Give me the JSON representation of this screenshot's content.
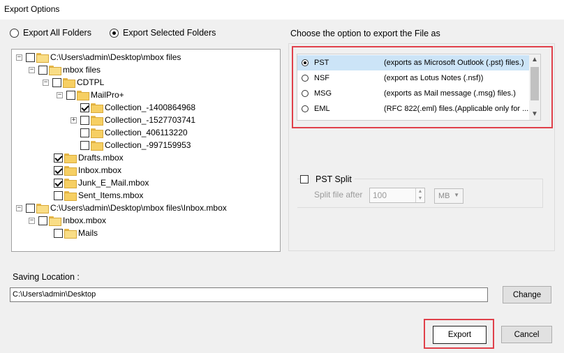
{
  "window": {
    "title": "Export Options"
  },
  "mode": {
    "options": [
      {
        "label": "Export All Folders",
        "selected": false
      },
      {
        "label": "Export Selected Folders",
        "selected": true
      }
    ]
  },
  "tree": {
    "nodes": [
      {
        "label": "C:\\Users\\admin\\Desktop\\mbox files",
        "expander": "−",
        "checked": false
      },
      {
        "label": "mbox files",
        "expander": "−",
        "checked": false
      },
      {
        "label": "CDTPL",
        "expander": "−",
        "checked": false
      },
      {
        "label": "MailPro+",
        "expander": "−",
        "checked": false
      },
      {
        "label": "Collection_-1400864968",
        "expander": "",
        "checked": true
      },
      {
        "label": "Collection_-1527703741",
        "expander": "+",
        "checked": false
      },
      {
        "label": "Collection_406113220",
        "expander": "",
        "checked": false
      },
      {
        "label": "Collection_-997159953",
        "expander": "",
        "checked": false
      },
      {
        "label": "Drafts.mbox",
        "expander": "",
        "checked": true
      },
      {
        "label": "Inbox.mbox",
        "expander": "",
        "checked": true
      },
      {
        "label": "Junk_E_Mail.mbox",
        "expander": "",
        "checked": true
      },
      {
        "label": "Sent_Items.mbox",
        "expander": "",
        "checked": false
      },
      {
        "label": "C:\\Users\\admin\\Desktop\\mbox files\\Inbox.mbox",
        "expander": "−",
        "checked": false
      },
      {
        "label": "Inbox.mbox",
        "expander": "−",
        "checked": false
      },
      {
        "label": "Mails",
        "expander": "",
        "checked": false
      }
    ]
  },
  "export_format": {
    "heading": "Choose the option to export the File as",
    "options": [
      {
        "format": "PST",
        "description": "(exports as Microsoft Outlook (.pst) files.)",
        "selected": true
      },
      {
        "format": "NSF",
        "description": "(export as Lotus Notes (.nsf))",
        "selected": false
      },
      {
        "format": "MSG",
        "description": "(exports as Mail message (.msg) files.)",
        "selected": false
      },
      {
        "format": "EML",
        "description": "(RFC 822(.eml) files.(Applicable only for ...",
        "selected": false
      }
    ]
  },
  "pst_split": {
    "label": "PST Split",
    "checked": false,
    "split_after_label": "Split file after",
    "size_value": "100",
    "unit": "MB"
  },
  "saving": {
    "label": "Saving Location :",
    "path": "C:\\Users\\admin\\Desktop",
    "change_label": "Change"
  },
  "actions": {
    "export_label": "Export",
    "cancel_label": "Cancel"
  },
  "colors": {
    "highlight_box": "#e0404a",
    "selection": "#cce4f7",
    "folder": "#f6cf63"
  }
}
